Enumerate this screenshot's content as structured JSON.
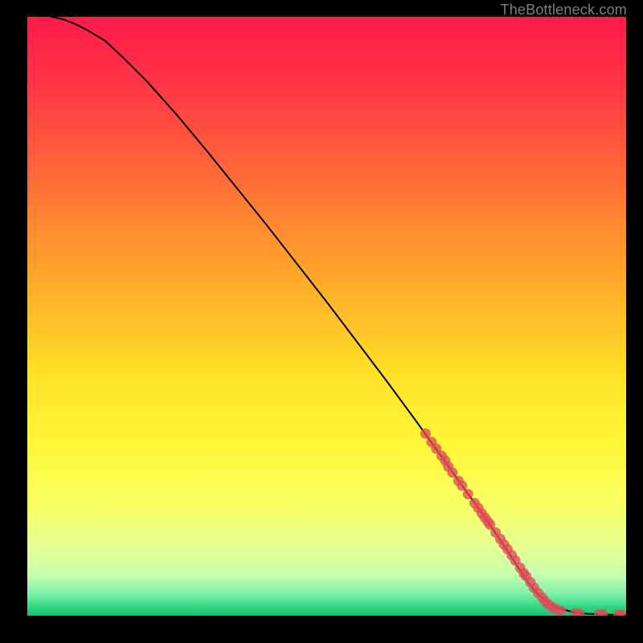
{
  "watermark": "TheBottleneck.com",
  "chart_data": {
    "type": "line",
    "title": "",
    "xlabel": "",
    "ylabel": "",
    "xlim": [
      0,
      100
    ],
    "ylim": [
      0,
      100
    ],
    "background_gradient": {
      "stops": [
        {
          "offset": 0.0,
          "color": "#ff1a4b"
        },
        {
          "offset": 0.1,
          "color": "#ff3246"
        },
        {
          "offset": 0.22,
          "color": "#ff5a3c"
        },
        {
          "offset": 0.35,
          "color": "#ff8a30"
        },
        {
          "offset": 0.48,
          "color": "#ffb728"
        },
        {
          "offset": 0.6,
          "color": "#ffe227"
        },
        {
          "offset": 0.72,
          "color": "#fff83a"
        },
        {
          "offset": 0.82,
          "color": "#f8ff66"
        },
        {
          "offset": 0.88,
          "color": "#e8ff90"
        },
        {
          "offset": 0.93,
          "color": "#c9ffad"
        },
        {
          "offset": 0.965,
          "color": "#7af0a8"
        },
        {
          "offset": 0.985,
          "color": "#2fd882"
        },
        {
          "offset": 1.0,
          "color": "#1fbf74"
        }
      ]
    },
    "series": [
      {
        "name": "curve",
        "type": "line",
        "color": "#000000",
        "x": [
          4,
          6,
          8,
          10,
          13,
          16,
          20,
          25,
          30,
          35,
          40,
          45,
          50,
          55,
          60,
          65,
          70,
          73,
          76,
          79,
          81.5,
          83,
          85,
          88,
          92,
          96,
          100
        ],
        "y": [
          100,
          99.6,
          98.8,
          97.8,
          96.0,
          93.2,
          89.2,
          83.6,
          77.6,
          71.4,
          65.2,
          58.8,
          52.4,
          45.8,
          39.2,
          32.4,
          25.4,
          21.2,
          17.0,
          12.6,
          8.8,
          6.4,
          3.8,
          1.4,
          0.4,
          0.2,
          0.1
        ]
      },
      {
        "name": "markers",
        "type": "scatter",
        "color": "#e04b56",
        "x": [
          66.5,
          67.5,
          68.3,
          69.2,
          69.8,
          70.3,
          71.0,
          72.0,
          72.6,
          73.6,
          74.7,
          75.3,
          75.9,
          76.4,
          76.9,
          77.3,
          78.2,
          79.0,
          79.6,
          80.2,
          80.9,
          81.5,
          82.3,
          82.9,
          83.3,
          84.0,
          84.6,
          85.3,
          86.0,
          86.5,
          87.1,
          87.7,
          88.4,
          89.1,
          91.5,
          92.2,
          95.5,
          96.1,
          98.7,
          99.3
        ],
        "y": [
          30.4,
          29.0,
          27.9,
          26.7,
          25.9,
          24.9,
          23.9,
          22.5,
          21.7,
          20.3,
          18.8,
          18.0,
          17.1,
          16.4,
          15.7,
          15.2,
          13.9,
          12.8,
          11.9,
          11.1,
          10.1,
          9.2,
          8.0,
          7.1,
          6.6,
          5.6,
          4.7,
          3.8,
          3.0,
          2.4,
          1.8,
          1.4,
          1.0,
          0.8,
          0.4,
          0.3,
          0.2,
          0.2,
          0.15,
          0.15
        ]
      }
    ]
  }
}
